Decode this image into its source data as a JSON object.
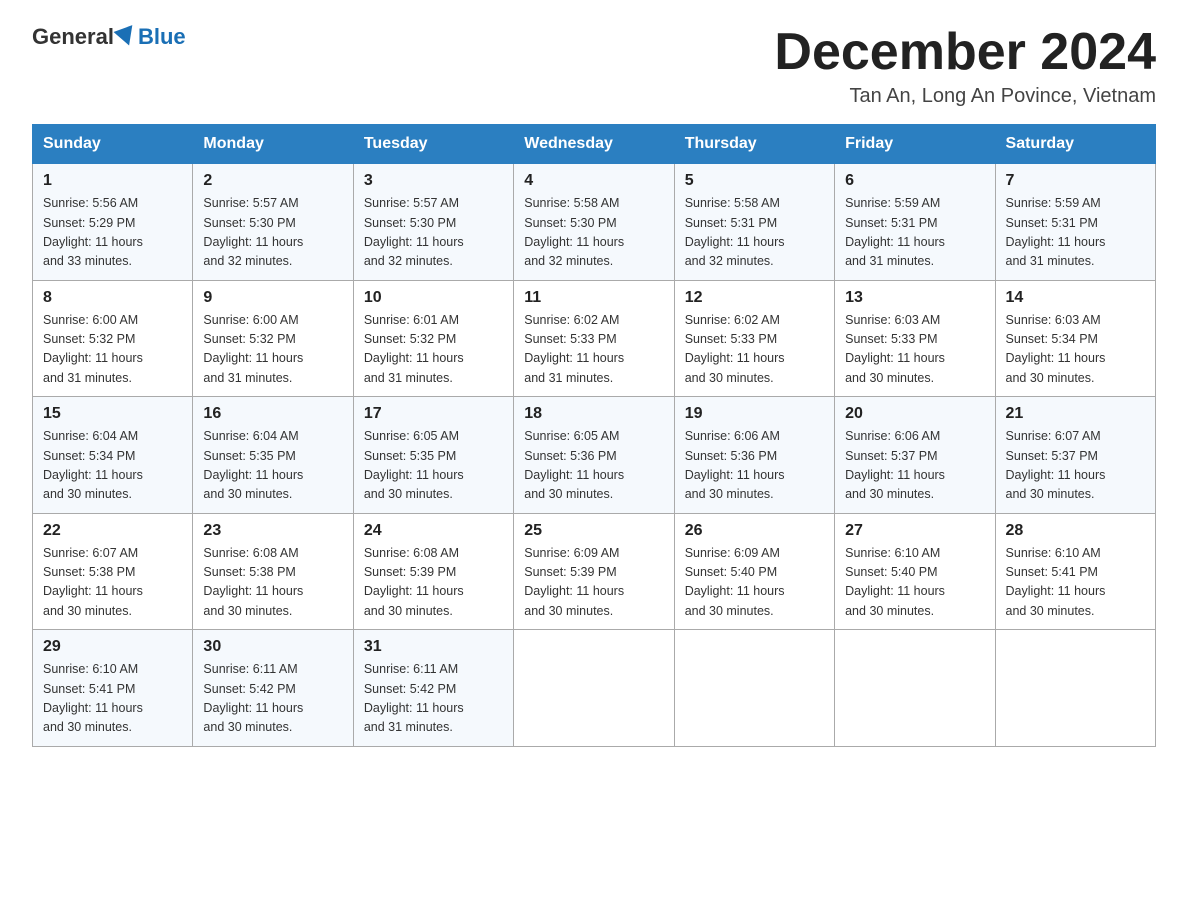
{
  "logo": {
    "general": "General",
    "blue": "Blue"
  },
  "header": {
    "month_year": "December 2024",
    "location": "Tan An, Long An Povince, Vietnam"
  },
  "days_of_week": [
    "Sunday",
    "Monday",
    "Tuesday",
    "Wednesday",
    "Thursday",
    "Friday",
    "Saturday"
  ],
  "weeks": [
    [
      {
        "day": "1",
        "sunrise": "5:56 AM",
        "sunset": "5:29 PM",
        "daylight": "11 hours and 33 minutes."
      },
      {
        "day": "2",
        "sunrise": "5:57 AM",
        "sunset": "5:30 PM",
        "daylight": "11 hours and 32 minutes."
      },
      {
        "day": "3",
        "sunrise": "5:57 AM",
        "sunset": "5:30 PM",
        "daylight": "11 hours and 32 minutes."
      },
      {
        "day": "4",
        "sunrise": "5:58 AM",
        "sunset": "5:30 PM",
        "daylight": "11 hours and 32 minutes."
      },
      {
        "day": "5",
        "sunrise": "5:58 AM",
        "sunset": "5:31 PM",
        "daylight": "11 hours and 32 minutes."
      },
      {
        "day": "6",
        "sunrise": "5:59 AM",
        "sunset": "5:31 PM",
        "daylight": "11 hours and 31 minutes."
      },
      {
        "day": "7",
        "sunrise": "5:59 AM",
        "sunset": "5:31 PM",
        "daylight": "11 hours and 31 minutes."
      }
    ],
    [
      {
        "day": "8",
        "sunrise": "6:00 AM",
        "sunset": "5:32 PM",
        "daylight": "11 hours and 31 minutes."
      },
      {
        "day": "9",
        "sunrise": "6:00 AM",
        "sunset": "5:32 PM",
        "daylight": "11 hours and 31 minutes."
      },
      {
        "day": "10",
        "sunrise": "6:01 AM",
        "sunset": "5:32 PM",
        "daylight": "11 hours and 31 minutes."
      },
      {
        "day": "11",
        "sunrise": "6:02 AM",
        "sunset": "5:33 PM",
        "daylight": "11 hours and 31 minutes."
      },
      {
        "day": "12",
        "sunrise": "6:02 AM",
        "sunset": "5:33 PM",
        "daylight": "11 hours and 30 minutes."
      },
      {
        "day": "13",
        "sunrise": "6:03 AM",
        "sunset": "5:33 PM",
        "daylight": "11 hours and 30 minutes."
      },
      {
        "day": "14",
        "sunrise": "6:03 AM",
        "sunset": "5:34 PM",
        "daylight": "11 hours and 30 minutes."
      }
    ],
    [
      {
        "day": "15",
        "sunrise": "6:04 AM",
        "sunset": "5:34 PM",
        "daylight": "11 hours and 30 minutes."
      },
      {
        "day": "16",
        "sunrise": "6:04 AM",
        "sunset": "5:35 PM",
        "daylight": "11 hours and 30 minutes."
      },
      {
        "day": "17",
        "sunrise": "6:05 AM",
        "sunset": "5:35 PM",
        "daylight": "11 hours and 30 minutes."
      },
      {
        "day": "18",
        "sunrise": "6:05 AM",
        "sunset": "5:36 PM",
        "daylight": "11 hours and 30 minutes."
      },
      {
        "day": "19",
        "sunrise": "6:06 AM",
        "sunset": "5:36 PM",
        "daylight": "11 hours and 30 minutes."
      },
      {
        "day": "20",
        "sunrise": "6:06 AM",
        "sunset": "5:37 PM",
        "daylight": "11 hours and 30 minutes."
      },
      {
        "day": "21",
        "sunrise": "6:07 AM",
        "sunset": "5:37 PM",
        "daylight": "11 hours and 30 minutes."
      }
    ],
    [
      {
        "day": "22",
        "sunrise": "6:07 AM",
        "sunset": "5:38 PM",
        "daylight": "11 hours and 30 minutes."
      },
      {
        "day": "23",
        "sunrise": "6:08 AM",
        "sunset": "5:38 PM",
        "daylight": "11 hours and 30 minutes."
      },
      {
        "day": "24",
        "sunrise": "6:08 AM",
        "sunset": "5:39 PM",
        "daylight": "11 hours and 30 minutes."
      },
      {
        "day": "25",
        "sunrise": "6:09 AM",
        "sunset": "5:39 PM",
        "daylight": "11 hours and 30 minutes."
      },
      {
        "day": "26",
        "sunrise": "6:09 AM",
        "sunset": "5:40 PM",
        "daylight": "11 hours and 30 minutes."
      },
      {
        "day": "27",
        "sunrise": "6:10 AM",
        "sunset": "5:40 PM",
        "daylight": "11 hours and 30 minutes."
      },
      {
        "day": "28",
        "sunrise": "6:10 AM",
        "sunset": "5:41 PM",
        "daylight": "11 hours and 30 minutes."
      }
    ],
    [
      {
        "day": "29",
        "sunrise": "6:10 AM",
        "sunset": "5:41 PM",
        "daylight": "11 hours and 30 minutes."
      },
      {
        "day": "30",
        "sunrise": "6:11 AM",
        "sunset": "5:42 PM",
        "daylight": "11 hours and 30 minutes."
      },
      {
        "day": "31",
        "sunrise": "6:11 AM",
        "sunset": "5:42 PM",
        "daylight": "11 hours and 31 minutes."
      },
      null,
      null,
      null,
      null
    ]
  ],
  "labels": {
    "sunrise": "Sunrise:",
    "sunset": "Sunset:",
    "daylight": "Daylight:"
  }
}
